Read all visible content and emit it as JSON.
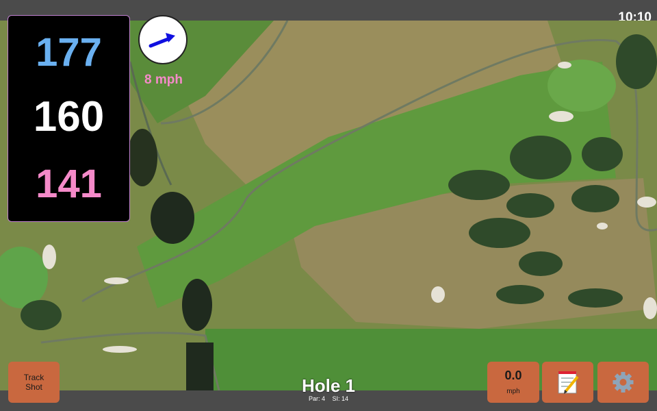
{
  "status_bar": {
    "time": "10:10"
  },
  "distances": {
    "back": "177",
    "middle": "160",
    "front": "141"
  },
  "wind": {
    "speed": "8 mph",
    "arrow_icon": "wind-arrow-icon",
    "arrow_color": "#1010e0"
  },
  "hole": {
    "title": "Hole 1",
    "par": "Par: 4",
    "stroke_index": "SI: 14"
  },
  "buttons": {
    "track_shot_line1": "Track",
    "track_shot_line2": "Shot",
    "speed_value": "0.0",
    "speed_unit": "mph",
    "notes_icon": "notepad-icon",
    "settings_icon": "gear-icon"
  },
  "colors": {
    "back_distance": "#6ab0f0",
    "middle_distance": "#ffffff",
    "front_distance": "#f58ac9",
    "button_bg": "#c9683f"
  }
}
